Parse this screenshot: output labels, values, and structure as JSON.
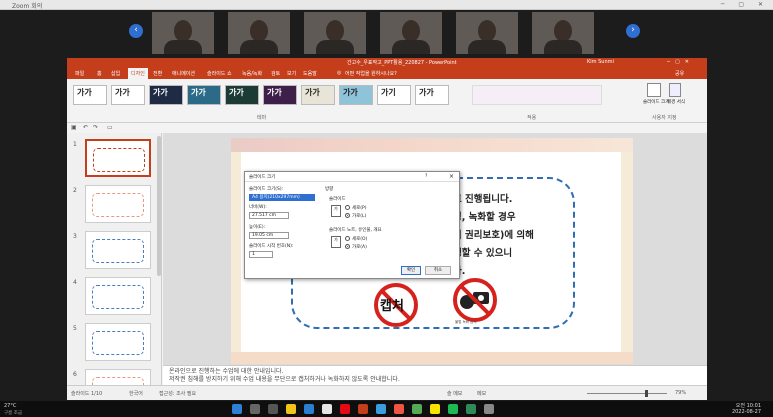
{
  "zoom": {
    "title": "Zoom 회의"
  },
  "participants": [
    "p1",
    "p2",
    "p3",
    "p4",
    "p5",
    "p6"
  ],
  "ppt": {
    "title": "간고수_우표작고_PPT활용_220827 - PowerPoint",
    "user": "Kim Sunmi",
    "share": "공유",
    "search_hint": "어떤 작업을 원하시나요?",
    "tabs": [
      "파일",
      "홈",
      "삽입",
      "디자인",
      "전환",
      "애니메이션",
      "슬라이드 쇼",
      "녹음/녹화",
      "검토",
      "보기",
      "도움말"
    ],
    "active_tab": "디자인",
    "themes": [
      "가가",
      "가가",
      "가가",
      "가가",
      "가가",
      "가가",
      "가가",
      "가가",
      "가기",
      "가가"
    ],
    "group_theme": "테마",
    "group_variant": "적용",
    "group_customize": "사용자 지정",
    "slide_size_btn": "슬라이드 크기",
    "bg_format_btn": "배경 서식",
    "thumb_nums": [
      "1",
      "2",
      "3",
      "4",
      "5",
      "6"
    ],
    "slide_text": [
      "로 진행됩니다.",
      "영, 녹화할 경우",
      "의 권리보호)에 의해",
      "생할 수 있으니",
      "다."
    ],
    "capture_text": "캡처",
    "camera_text": "불법 녹화 금지",
    "notes": [
      "온라인으로 진행하는 수업에 대한 안내입니다.",
      "저작권 침해를 방지하기 위해 수업 내용을 무단으로 캡처하거나 녹화하지 않도록 안내합니다."
    ],
    "status": {
      "slide": "슬라이드 1/10",
      "lang": "한국어",
      "a11y": "접근성: 조사 필요",
      "notes": "슬 메모",
      "comments": "메모",
      "zoom": "79%"
    }
  },
  "dialog": {
    "title": "슬라이드 크기",
    "help": "?",
    "close": "×",
    "size_label": "슬라이드 크기(S):",
    "size_value": "A4 용지(210x297mm)",
    "width_label": "너비(W):",
    "width_value": "27.517 cm",
    "height_label": "높이(E):",
    "height_value": "19.05 cm",
    "start_label": "슬라이드 시작 번호(N):",
    "start_value": "1",
    "orient_label": "방향",
    "slides_label": "슬라이드",
    "portrait": "세로(P)",
    "landscape": "가로(L)",
    "notes_label": "슬라이드 노트, 유인물, 개요",
    "portrait2": "세로(O)",
    "landscape2": "가로(A)",
    "ok": "확인",
    "cancel": "취소"
  },
  "taskbar": {
    "weather": "27°C",
    "weather_sub": "구름 조금",
    "time": "오전 10:01",
    "date": "2022-08-27"
  },
  "colors": {
    "ppt_red": "#c43e1c",
    "dash_blue": "#2f6db5",
    "prohibit_red": "#d6221c"
  }
}
